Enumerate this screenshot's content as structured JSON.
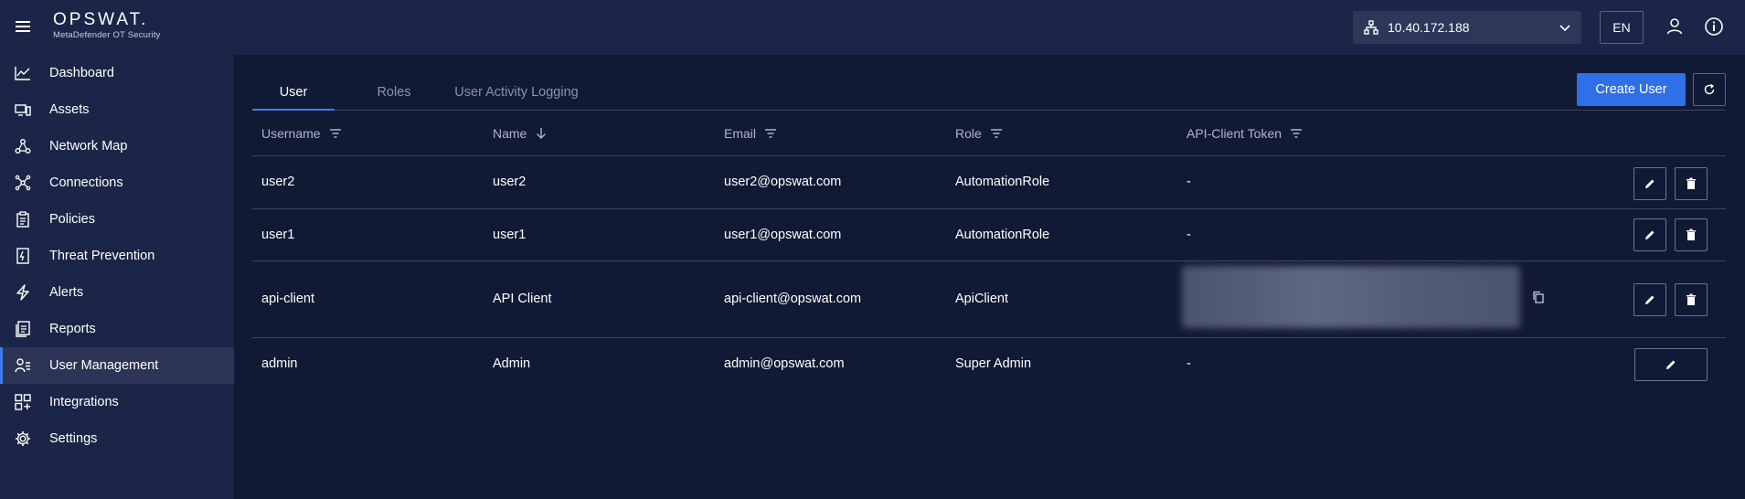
{
  "header": {
    "logo_main": "OPSWAT.",
    "logo_sub": "MetaDefender OT Security",
    "ip_address": "10.40.172.188",
    "language": "EN"
  },
  "sidebar": {
    "items": [
      {
        "label": "Dashboard",
        "icon": "chart-line-icon"
      },
      {
        "label": "Assets",
        "icon": "devices-icon"
      },
      {
        "label": "Network Map",
        "icon": "network-map-icon"
      },
      {
        "label": "Connections",
        "icon": "connections-icon"
      },
      {
        "label": "Policies",
        "icon": "clipboard-icon"
      },
      {
        "label": "Threat Prevention",
        "icon": "threat-file-icon"
      },
      {
        "label": "Alerts",
        "icon": "bolt-icon"
      },
      {
        "label": "Reports",
        "icon": "reports-icon"
      },
      {
        "label": "User Management",
        "icon": "user-list-icon",
        "active": true
      },
      {
        "label": "Integrations",
        "icon": "grid-plus-icon"
      },
      {
        "label": "Settings",
        "icon": "gear-icon"
      }
    ]
  },
  "tabs": [
    {
      "label": "User",
      "active": true
    },
    {
      "label": "Roles"
    },
    {
      "label": "User Activity Logging"
    }
  ],
  "toolbar": {
    "create_user_label": "Create User"
  },
  "table": {
    "columns": [
      {
        "label": "Username",
        "indicator": "filter"
      },
      {
        "label": "Name",
        "indicator": "sort-desc"
      },
      {
        "label": "Email",
        "indicator": "filter"
      },
      {
        "label": "Role",
        "indicator": "filter"
      },
      {
        "label": "API-Client Token",
        "indicator": "filter"
      }
    ],
    "rows": [
      {
        "username": "user2",
        "name": "user2",
        "email": "user2@opswat.com",
        "role": "AutomationRole",
        "token": "-"
      },
      {
        "username": "user1",
        "name": "user1",
        "email": "user1@opswat.com",
        "role": "AutomationRole",
        "token": "-"
      },
      {
        "username": "api-client",
        "name": "API Client",
        "email": "api-client@opswat.com",
        "role": "ApiClient",
        "token": ""
      },
      {
        "username": "admin",
        "name": "Admin",
        "email": "admin@opswat.com",
        "role": "Super Admin",
        "token": "-"
      }
    ]
  },
  "colors": {
    "background": "#111a35",
    "sidebar": "#1b2547",
    "accent": "#2f6fe8"
  }
}
